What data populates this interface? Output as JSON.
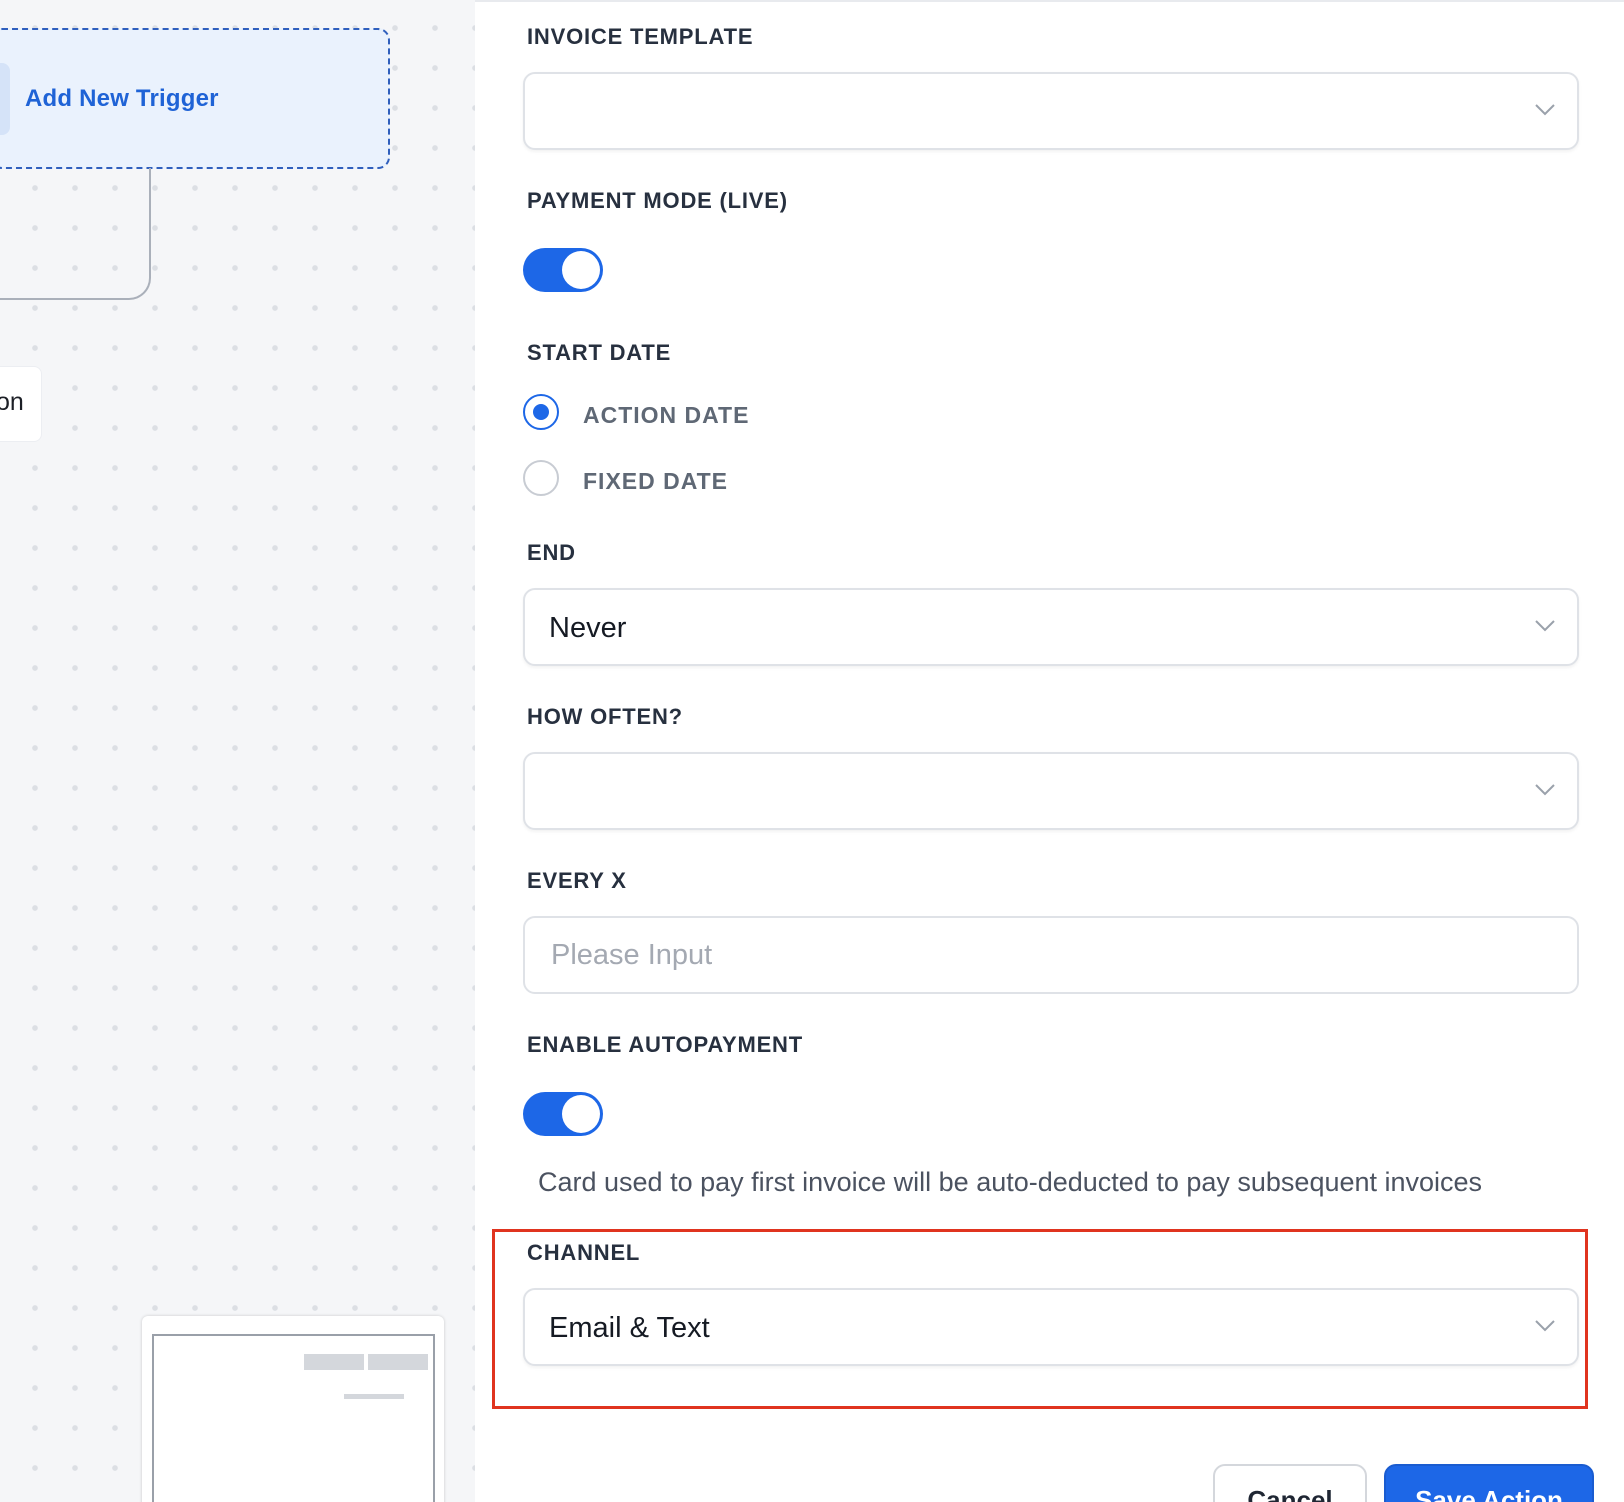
{
  "canvas": {
    "trigger_label": "Add New Trigger",
    "action_partial_text": "on"
  },
  "form": {
    "invoice_template": {
      "label": "INVOICE TEMPLATE",
      "value": ""
    },
    "payment_mode": {
      "label": "PAYMENT MODE (LIVE)",
      "on": true
    },
    "start_date": {
      "label": "START DATE",
      "options": [
        {
          "label": "ACTION DATE",
          "selected": true
        },
        {
          "label": "FIXED DATE",
          "selected": false
        }
      ]
    },
    "end": {
      "label": "END",
      "value": "Never"
    },
    "how_often": {
      "label": "HOW OFTEN?",
      "value": ""
    },
    "every_x": {
      "label": "EVERY X",
      "placeholder": "Please Input",
      "value": ""
    },
    "autopayment": {
      "label": "ENABLE AUTOPAYMENT",
      "on": true,
      "helper": "Card used to pay first invoice will be auto-deducted to pay subsequent invoices"
    },
    "channel": {
      "label": "CHANNEL",
      "value": "Email & Text"
    }
  },
  "footer": {
    "cancel_label": "Cancel",
    "save_label": "Save Action"
  },
  "colors": {
    "accent": "#1d67e7",
    "highlight": "#e0341f",
    "trigger_text": "#1f63d6"
  }
}
